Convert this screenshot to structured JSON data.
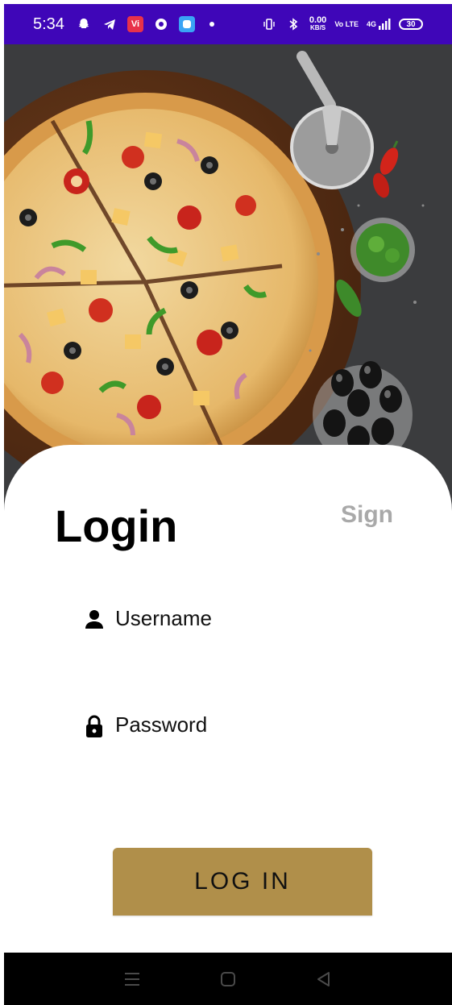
{
  "status_bar": {
    "time": "5:34",
    "notification_app_label": "Vi",
    "net_speed_value": "0.00",
    "net_speed_unit": "KB/S",
    "volte_label": "Vo LTE",
    "network_type": "4G",
    "battery": "30",
    "bg_color": "#3f06b8"
  },
  "hero": {
    "image_subject": "pizza-with-pizza-cutter-chilies-herbs-and-olives"
  },
  "login_card": {
    "title": "Login",
    "sign_tab_label": "Sign",
    "username": {
      "placeholder": "Username",
      "value": "",
      "icon": "person-icon"
    },
    "password": {
      "placeholder": "Password",
      "value": "",
      "icon": "lock-icon"
    },
    "login_button_label": "LOG IN",
    "accent_color": "#b08f4a"
  },
  "nav_bar": {
    "buttons": [
      "menu-icon",
      "home-icon",
      "back-icon"
    ]
  }
}
